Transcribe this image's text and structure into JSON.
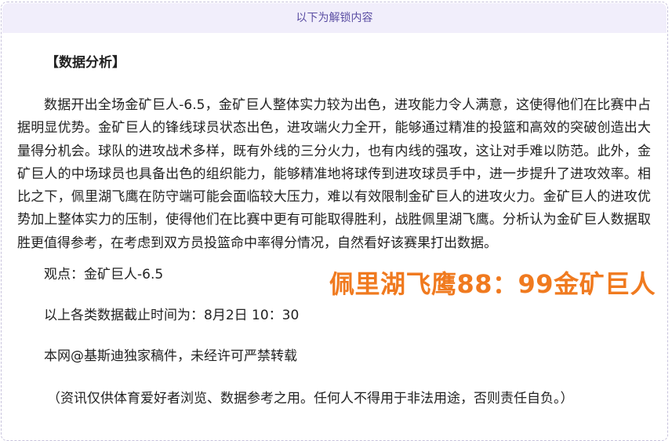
{
  "banner": {
    "label": "以下为解锁内容"
  },
  "article": {
    "heading": "【数据分析】",
    "paragraph": "数据开出全场金矿巨人-6.5，金矿巨人整体实力较为出色，进攻能力令人满意，这使得他们在比赛中占据明显优势。金矿巨人的锋线球员状态出色，进攻端火力全开，能够通过精准的投篮和高效的突破创造出大量得分机会。球队的进攻战术多样，既有外线的三分火力，也有内线的强攻，这让对手难以防范。此外，金矿巨人的中场球员也具备出色的组织能力，能够精准地将球传到进攻球员手中，进一步提升了进攻效率。相比之下，佩里湖飞鹰在防守端可能会面临较大压力，难以有效限制金矿巨人的进攻火力。金矿巨人的进攻优势加上整体实力的压制，使得他们在比赛中更有可能取得胜利，战胜佩里湖飞鹰。分析认为金矿巨人数据取胜更值得参考，在考虑到双方员投篮命中率得分情况，自然看好该赛果打出数据。",
    "viewpoint": "观点：金矿巨人-6.5",
    "cutoff_time": "以上各类数据截止时间为：8月2日 10：30",
    "copyright": "本网@基斯迪独家稿件，未经许可严禁转载",
    "disclaimer": "（资讯仅供体育爱好者浏览、数据参考之用。任何人不得用于非法用途，否则责任自负。）"
  },
  "score_overlay": {
    "text": "佩里湖飞鹰88：99金矿巨人",
    "color": "#f07a1f"
  }
}
